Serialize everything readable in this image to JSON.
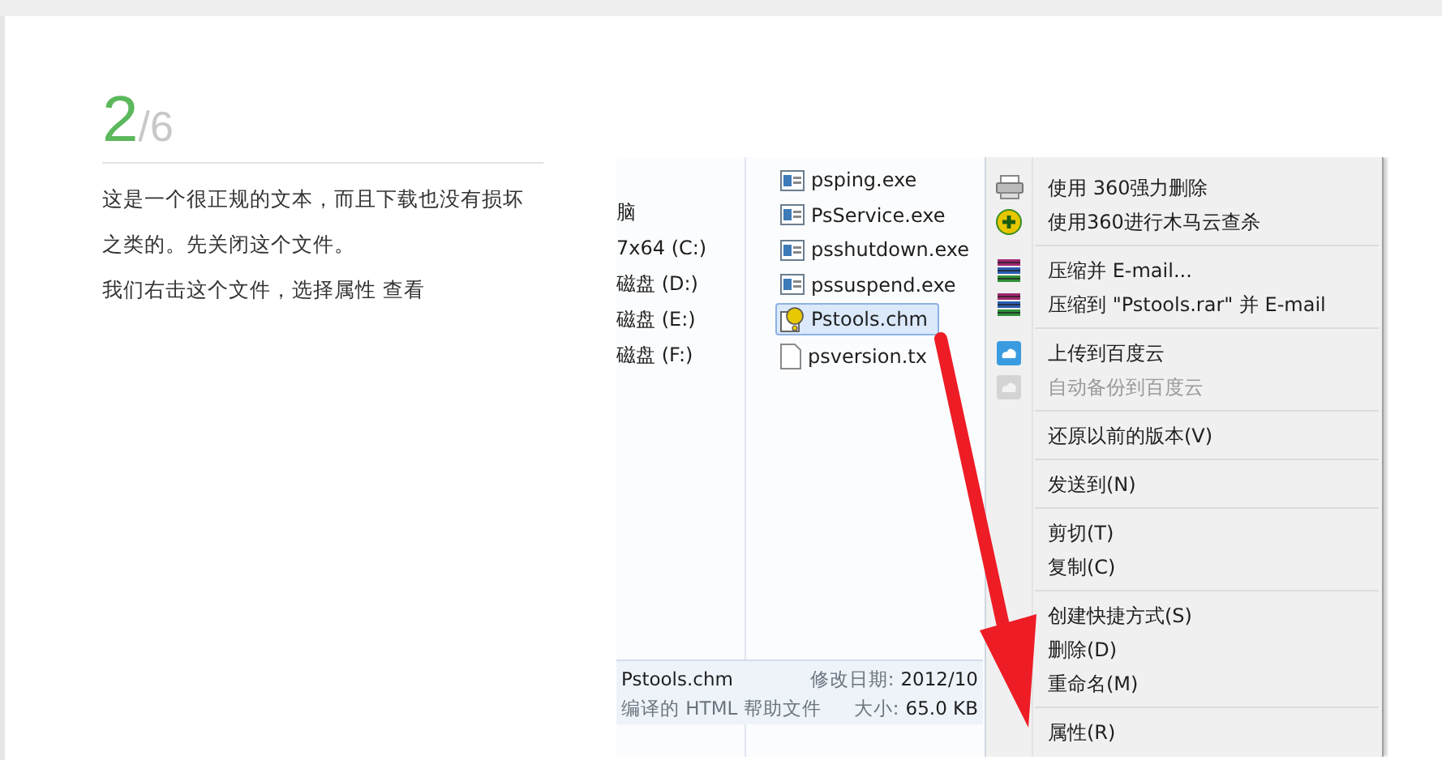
{
  "step": {
    "number": "2",
    "total": "/6"
  },
  "paragraphs": [
    "这是一个很正规的文本，而且下载也没有损坏之类的。先关闭这个文件。",
    "我们右击这个文件，选择属性 查看"
  ],
  "explorer": {
    "nav_items": [
      "脑",
      "7x64 (C:)",
      "磁盘 (D:)",
      "磁盘 (E:)",
      "磁盘 (F:)"
    ],
    "files": [
      {
        "name": "psping.exe",
        "kind": "exe",
        "selected": false
      },
      {
        "name": "PsService.exe",
        "kind": "exe",
        "selected": false
      },
      {
        "name": "psshutdown.exe",
        "kind": "exe",
        "selected": false
      },
      {
        "name": "pssuspend.exe",
        "kind": "exe",
        "selected": false
      },
      {
        "name": "Pstools.chm",
        "kind": "chm",
        "selected": true
      },
      {
        "name": "psversion.tx",
        "kind": "txt",
        "selected": false
      }
    ],
    "details": {
      "name": "Pstools.chm",
      "type": "编译的 HTML 帮助文件",
      "modified_label": "修改日期:",
      "modified_value": "2012/10",
      "size_label": "大小:",
      "size_value": "65.0 KB"
    }
  },
  "context_menu": {
    "groups": [
      [
        {
          "label": "使用 360强力删除",
          "kind": "shredder",
          "disabled": false
        },
        {
          "label": "使用360进行木马云查杀",
          "kind": "scan",
          "disabled": false
        }
      ],
      [
        {
          "label": "压缩并 E-mail...",
          "kind": "archive",
          "disabled": false
        },
        {
          "label": "压缩到 \"Pstools.rar\" 并 E-mail",
          "kind": "archive",
          "disabled": false
        }
      ],
      [
        {
          "label": "上传到百度云",
          "kind": "cloud",
          "disabled": false
        },
        {
          "label": "自动备份到百度云",
          "kind": "cloud",
          "disabled": true
        }
      ],
      [
        {
          "label": "还原以前的版本(V)",
          "disabled": false
        }
      ],
      [
        {
          "label": "发送到(N)",
          "disabled": false
        }
      ],
      [
        {
          "label": "剪切(T)",
          "disabled": false
        },
        {
          "label": "复制(C)",
          "disabled": false
        }
      ],
      [
        {
          "label": "创建快捷方式(S)",
          "disabled": false
        },
        {
          "label": "删除(D)",
          "disabled": false
        },
        {
          "label": "重命名(M)",
          "disabled": false
        }
      ],
      [
        {
          "label": "属性(R)",
          "disabled": false
        }
      ]
    ]
  }
}
